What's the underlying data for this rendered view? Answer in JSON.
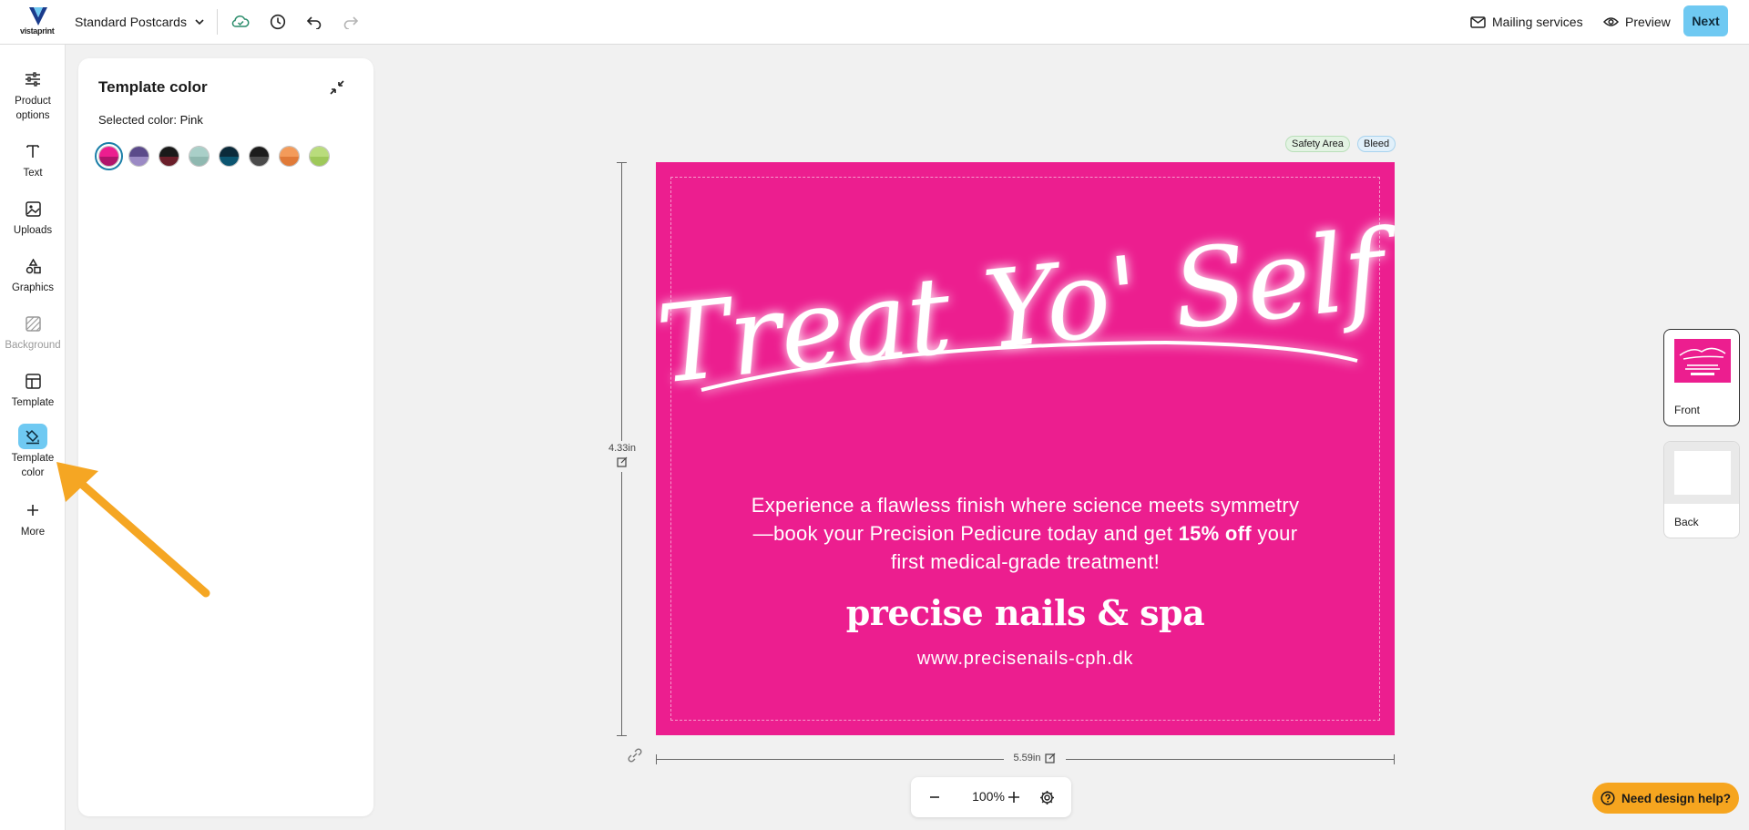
{
  "app": {
    "logo_text": "vistaprint",
    "product_name": "Standard Postcards"
  },
  "toolbar": {
    "mailing_label": "Mailing services",
    "preview_label": "Preview",
    "next_label": "Next"
  },
  "rail": {
    "items": [
      {
        "label": "Product options",
        "icon": "sliders-icon"
      },
      {
        "label": "Text",
        "icon": "text-icon"
      },
      {
        "label": "Uploads",
        "icon": "image-icon"
      },
      {
        "label": "Graphics",
        "icon": "shapes-icon"
      },
      {
        "label": "Background",
        "icon": "background-icon"
      },
      {
        "label": "Template",
        "icon": "template-icon"
      },
      {
        "label": "Template color",
        "icon": "paint-bucket-icon"
      },
      {
        "label": "More",
        "icon": "plus-icon"
      }
    ]
  },
  "panel": {
    "title": "Template color",
    "selected_prefix": "Selected color: ",
    "selected_value": "Pink",
    "swatches": [
      {
        "name": "Pink",
        "top": "#ec1e8f",
        "bottom": "#b0146b"
      },
      {
        "name": "Purple",
        "top": "#5b4a8a",
        "bottom": "#9b8ac4"
      },
      {
        "name": "Black-red",
        "top": "#1a1a1a",
        "bottom": "#6b1f2a"
      },
      {
        "name": "Sage",
        "top": "#a9cfc8",
        "bottom": "#8fb8b0"
      },
      {
        "name": "Navy",
        "top": "#0b2a3a",
        "bottom": "#0b5570"
      },
      {
        "name": "Charcoal",
        "top": "#1c1c1c",
        "bottom": "#4a4a4a"
      },
      {
        "name": "Orange",
        "top": "#f39b5a",
        "bottom": "#e07a38"
      },
      {
        "name": "Lime",
        "top": "#b9dc7c",
        "bottom": "#9ec85a"
      }
    ]
  },
  "canvas": {
    "safety_label": "Safety Area",
    "bleed_label": "Bleed",
    "height_label": "4.33in",
    "width_label": "5.59in"
  },
  "card": {
    "headline": "Treat Yo' Self",
    "body_1": "Experience a flawless finish where science meets symmetry—book your Precision Pedicure today and get ",
    "body_bold": "15% off",
    "body_2": " your first medical-grade treatment!",
    "brand": "precise nails & spa",
    "url": "www.precisenails-cph.dk",
    "background": "#ec1e8f"
  },
  "zoom": {
    "value": "100%"
  },
  "pages": {
    "front_label": "Front",
    "back_label": "Back"
  },
  "help": {
    "label": "Need design help?"
  }
}
